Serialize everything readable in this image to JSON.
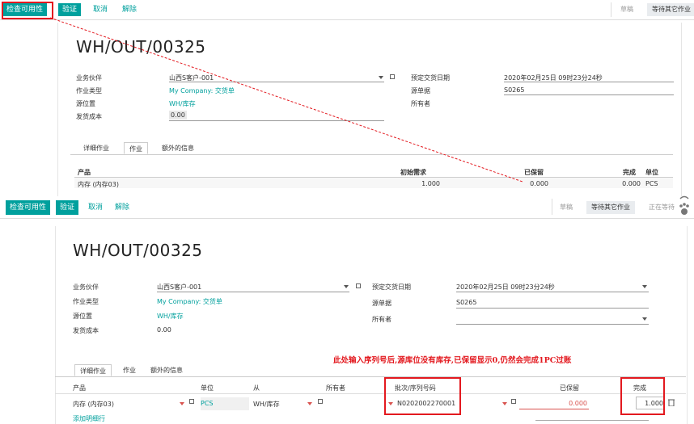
{
  "top": {
    "toolbar": {
      "check": "检查可用性",
      "validate": "验证",
      "cancel": "取消",
      "unreserve": "解除"
    },
    "stages": [
      "草稿",
      "等待其它作业"
    ],
    "title": "WH/OUT/00325",
    "fields": {
      "partner_label": "业务伙伴",
      "partner_value": "山西S客户-001",
      "op_type_label": "作业类型",
      "op_type_value": "My Company: 交货单",
      "src_loc_label": "源位置",
      "src_loc_value": "WH/库存",
      "ship_cost_label": "发货成本",
      "ship_cost_value": "0.00",
      "sched_label": "预定交货日期",
      "sched_value": "2020年02月25日 09时23分24秒",
      "origin_label": "源单据",
      "origin_value": "S0265",
      "owner_label": "所有者"
    },
    "tabs": [
      "详细作业",
      "作业",
      "额外的信息"
    ],
    "table": {
      "headers": [
        "产品",
        "初始需求",
        "已保留",
        "完成",
        "单位"
      ],
      "row": [
        "内存 (内存03)",
        "1.000",
        "0.000",
        "0.000",
        "PCS"
      ]
    }
  },
  "bottom": {
    "toolbar": {
      "check": "检查可用性",
      "validate": "验证",
      "cancel": "取消",
      "unreserve": "解除"
    },
    "stages": [
      "草稿",
      "等待其它作业",
      "正在等待"
    ],
    "title": "WH/OUT/00325",
    "fields": {
      "partner_label": "业务伙伴",
      "partner_value": "山西S客户-001",
      "op_type_label": "作业类型",
      "op_type_value": "My Company: 交货单",
      "src_loc_label": "源位置",
      "src_loc_value": "WH/库存",
      "ship_cost_label": "发货成本",
      "ship_cost_value": "0.00",
      "sched_label": "预定交货日期",
      "sched_value": "2020年02月25日 09时23分24秒",
      "origin_label": "源单据",
      "origin_value": "S0265",
      "owner_label": "所有者"
    },
    "tabs": [
      "详细作业",
      "作业",
      "额外的信息"
    ],
    "table": {
      "headers": [
        "产品",
        "单位",
        "从",
        "所有者",
        "批次/序列号码",
        "已保留",
        "完成"
      ],
      "row": {
        "product": "内存 (内存03)",
        "uom": "PCS",
        "from": "WH/库存",
        "lot": "N0202002270001",
        "reserved": "0.000",
        "done": "1.000"
      },
      "add_line": "添加明细行"
    },
    "annotation": "此处输入序列号后,源库位没有库存,已保留显示0,仍然会完成1PC过账"
  },
  "colors": {
    "accent": "#00a09d",
    "annotation": "#e3191f"
  }
}
